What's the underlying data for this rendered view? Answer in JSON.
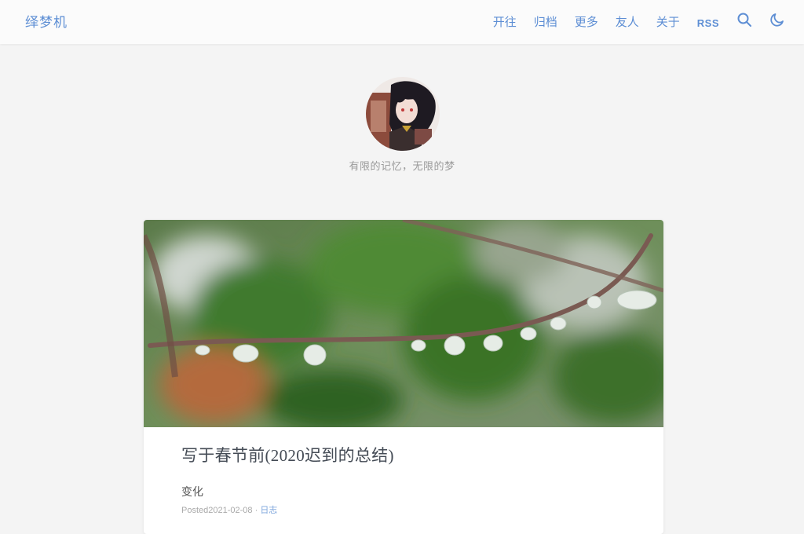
{
  "header": {
    "brand": "绎梦机",
    "nav": [
      "开往",
      "归档",
      "更多",
      "友人",
      "关于",
      "RSS"
    ],
    "icons": [
      "search-icon",
      "moon-icon"
    ],
    "accent": "#5d8ed4"
  },
  "hero": {
    "tagline": "有限的记忆，无限的梦"
  },
  "posts": [
    {
      "title": "写于春节前(2020迟到的总结)",
      "excerpt": "变化",
      "meta_prefix": "Posted",
      "date": "2021-02-08",
      "separator": " · ",
      "category": "日志"
    }
  ]
}
